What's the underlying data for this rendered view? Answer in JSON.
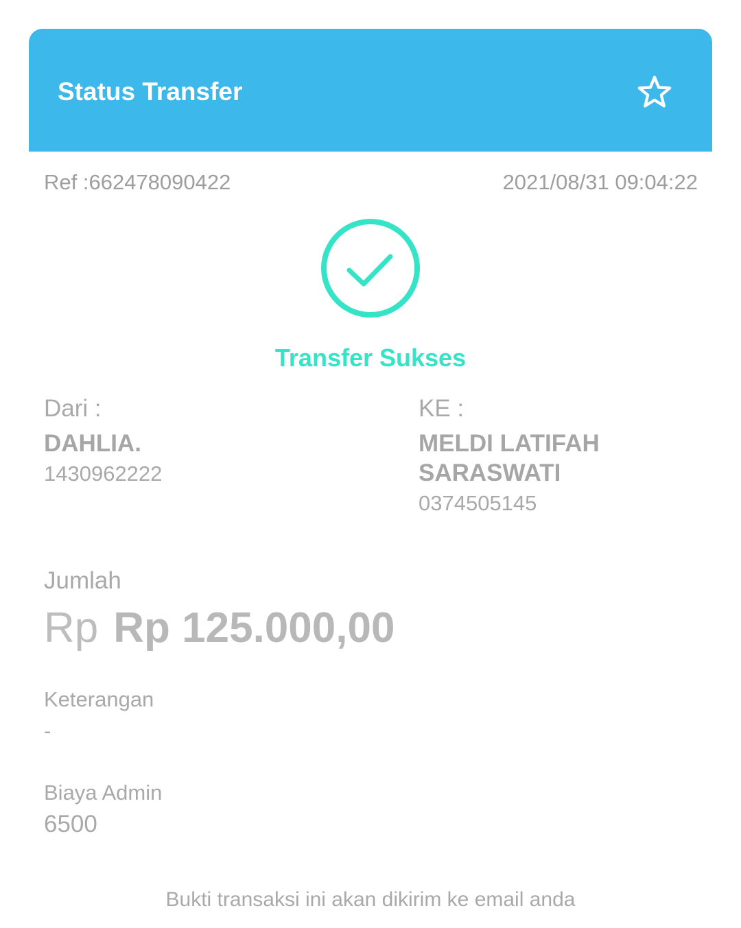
{
  "header": {
    "title": "Status Transfer",
    "favorite_icon": "star-outline-icon",
    "background_color": "#3db8ea"
  },
  "transaction": {
    "ref": "Ref :662478090422",
    "datetime": "2021/08/31 09:04:22"
  },
  "status": {
    "icon": "check-circle-icon",
    "text": "Transfer Sukses",
    "color": "#35e3c7"
  },
  "from": {
    "label": "Dari :",
    "name": "DAHLIA.",
    "account": "1430962222"
  },
  "to": {
    "label": "KE :",
    "name": "MELDI LATIFAH SARASWATI",
    "account": "0374505145"
  },
  "amount": {
    "label": "Jumlah",
    "currency": "Rp",
    "value": "Rp 125.000,00"
  },
  "note": {
    "label": "Keterangan",
    "value": "-"
  },
  "admin_fee": {
    "label": "Biaya Admin",
    "value": "6500"
  },
  "footer": {
    "text": "Bukti transaksi ini akan dikirim ke email anda"
  }
}
